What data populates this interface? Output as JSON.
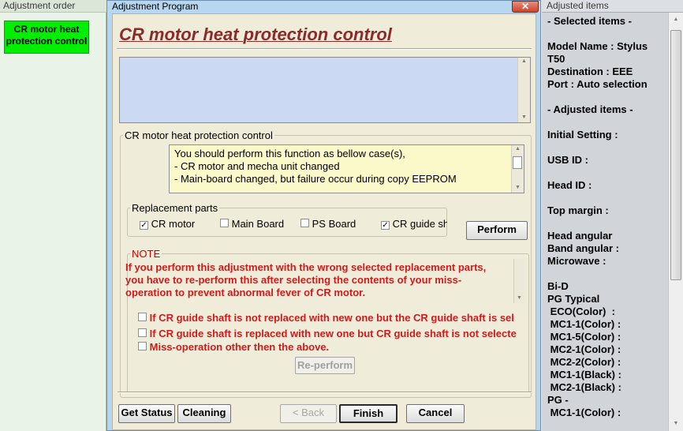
{
  "left_pane": {
    "header": "Adjustment order",
    "active_item": "CR motor heat protection control"
  },
  "dialog": {
    "title": "Adjustment Program",
    "close_glyph": "✕",
    "heading": "CR motor heat protection control",
    "group_title": "CR motor heat protection control",
    "message_lines": [
      "You should perform this function as bellow case(s),",
      "- CR motor and mecha unit changed",
      "- Main-board changed, but failure occur during copy EEPROM"
    ],
    "replacement": {
      "legend": "Replacement parts",
      "items": [
        {
          "label": "CR motor",
          "checked": true
        },
        {
          "label": "Main Board",
          "checked": false
        },
        {
          "label": "PS Board",
          "checked": false
        },
        {
          "label": "CR guide sha",
          "checked": true
        }
      ]
    },
    "perform_label": "Perform",
    "note": {
      "legend": "NOTE",
      "text": "If you perform this adjustment with the wrong selected replacement parts, you have to re-perform this after selecting the contents of your miss-operation to prevent abnormal fever of CR motor.",
      "options": [
        "If CR guide shaft is not replaced with new one but the CR guide shaft is sel",
        "If CR guide shaft is replaced with new one but CR guide shaft is not selecte",
        "Miss-operation other then the above."
      ],
      "reperform_label": "Re-perform"
    },
    "buttons": {
      "get_status": "Get Status",
      "cleaning": "Cleaning",
      "back": "< Back",
      "finish": "Finish",
      "cancel": "Cancel"
    }
  },
  "right_pane": {
    "header": "Adjusted items",
    "lines": [
      "- Selected items -",
      "",
      "Model Name : Stylus",
      "T50",
      "Destination : EEE",
      "Port : Auto selection",
      "",
      "- Adjusted items -",
      "",
      "Initial Setting :",
      "",
      "USB ID :",
      "",
      "Head ID :",
      "",
      "Top margin :",
      "",
      "Head angular",
      "Band angular :",
      "Microwave :",
      "",
      "Bi-D",
      "PG Typical",
      " ECO(Color)  :",
      " MC1-1(Color) :",
      " MC1-5(Color) :",
      " MC2-1(Color) :",
      " MC2-2(Color) :",
      " MC1-1(Black) :",
      " MC2-1(Black) :",
      "PG -",
      " MC1-1(Color) :"
    ]
  }
}
